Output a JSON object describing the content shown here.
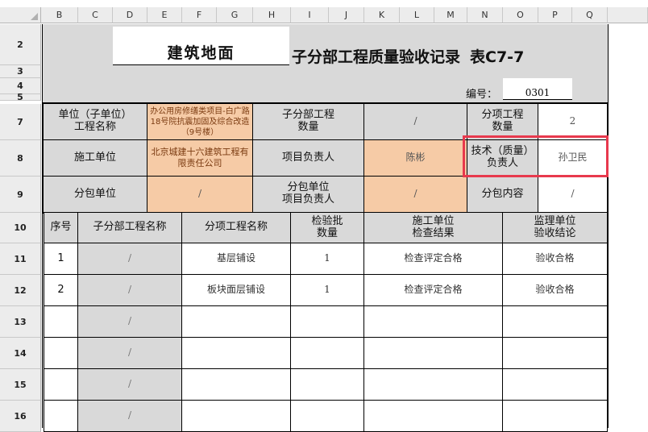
{
  "columns": [
    "B",
    "C",
    "D",
    "E",
    "F",
    "G",
    "H",
    "I",
    "J",
    "K",
    "L",
    "M",
    "N",
    "O",
    "P",
    "Q"
  ],
  "rows": [
    "2",
    "3",
    "4",
    "5",
    "7",
    "8",
    "9",
    "10",
    "11",
    "12",
    "13",
    "14",
    "15",
    "16"
  ],
  "title": {
    "project_name": "建筑地面",
    "main": "子分部工程质量验收记录",
    "table_no": "表C7-7"
  },
  "serial": {
    "label": "编号：",
    "value": "0301"
  },
  "info": {
    "unit_label": "单位（子单位）\n工程名称",
    "unit_value": "办公用房修缮类项目-白广路18号院抗震加固及综合改造（9号楼）",
    "sub_label": "子分部工程\n数量",
    "sub_value": "/",
    "item_label": "分项工程\n数量",
    "item_value": "2",
    "construct_label": "施工单位",
    "construct_value": "北京城建十六建筑工程有限责任公司",
    "pm_label": "项目负责人",
    "pm_value": "陈彬",
    "tech_label": "技术（质量）\n负责人",
    "tech_value": "孙卫民",
    "subc_label": "分包单位",
    "subc_value": "/",
    "subc_pm_label": "分包单位\n项目负责人",
    "subc_pm_value": "/",
    "subc_content_label": "分包内容",
    "subc_content_value": "/"
  },
  "table": {
    "headers": [
      "序号",
      "子分部工程名称",
      "分项工程名称",
      "检验批\n数量",
      "施工单位\n检查结果",
      "监理单位\n验收结论"
    ],
    "rows": [
      [
        "1",
        "/",
        "基层铺设",
        "1",
        "检查评定合格",
        "验收合格"
      ],
      [
        "2",
        "/",
        "板块面层铺设",
        "1",
        "检查评定合格",
        "验收合格"
      ],
      [
        "",
        "/",
        "",
        "",
        "",
        ""
      ],
      [
        "",
        "/",
        "",
        "",
        "",
        ""
      ],
      [
        "",
        "/",
        "",
        "",
        "",
        ""
      ],
      [
        "",
        "/",
        "",
        "",
        "",
        ""
      ]
    ]
  },
  "colors": {
    "gray": "#d9d9d9",
    "orange": "#f6cba6",
    "highlight": "#e8394d"
  }
}
